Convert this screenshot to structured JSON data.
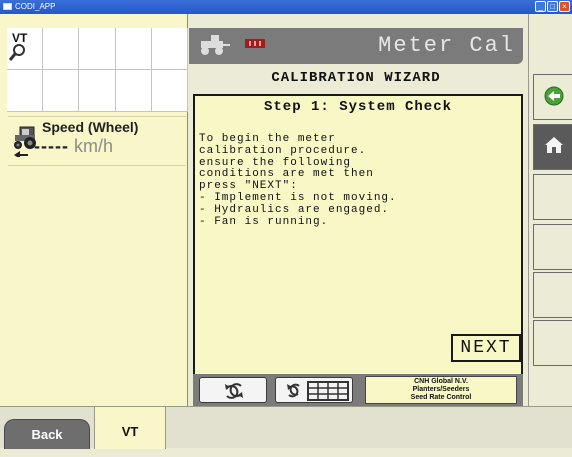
{
  "window": {
    "title": "CODI_APP"
  },
  "left": {
    "vt_label": "VT",
    "speed": {
      "title": "Speed (Wheel)",
      "value": "-----",
      "unit": "km/h"
    }
  },
  "header": {
    "title": "Meter Cal"
  },
  "wizard": {
    "title": "CALIBRATION WIZARD",
    "step_title": "Step 1: System Check",
    "body": "To begin the meter\ncalibration procedure.\nensure the following\nconditions are met then\npress \"NEXT\":\n- Implement is not moving.\n- Hydraulics are engaged.\n- Fan is running.",
    "next_label": "NEXT"
  },
  "footer": {
    "cnh_lines": [
      "CNH Global N.V.",
      "Planters/Seeders",
      "Seed Rate Control"
    ]
  },
  "tabs": {
    "back": "Back",
    "vt": "VT"
  },
  "colors": {
    "accent_green": "#4aa03a",
    "header_gray": "#7b7b7b",
    "panel_yellow": "#f8f7c6"
  },
  "icons": [
    "search-icon",
    "tractor-icon",
    "meter-icon",
    "rotate-icon",
    "keypad-icon",
    "back-arrow-icon",
    "home-icon"
  ]
}
